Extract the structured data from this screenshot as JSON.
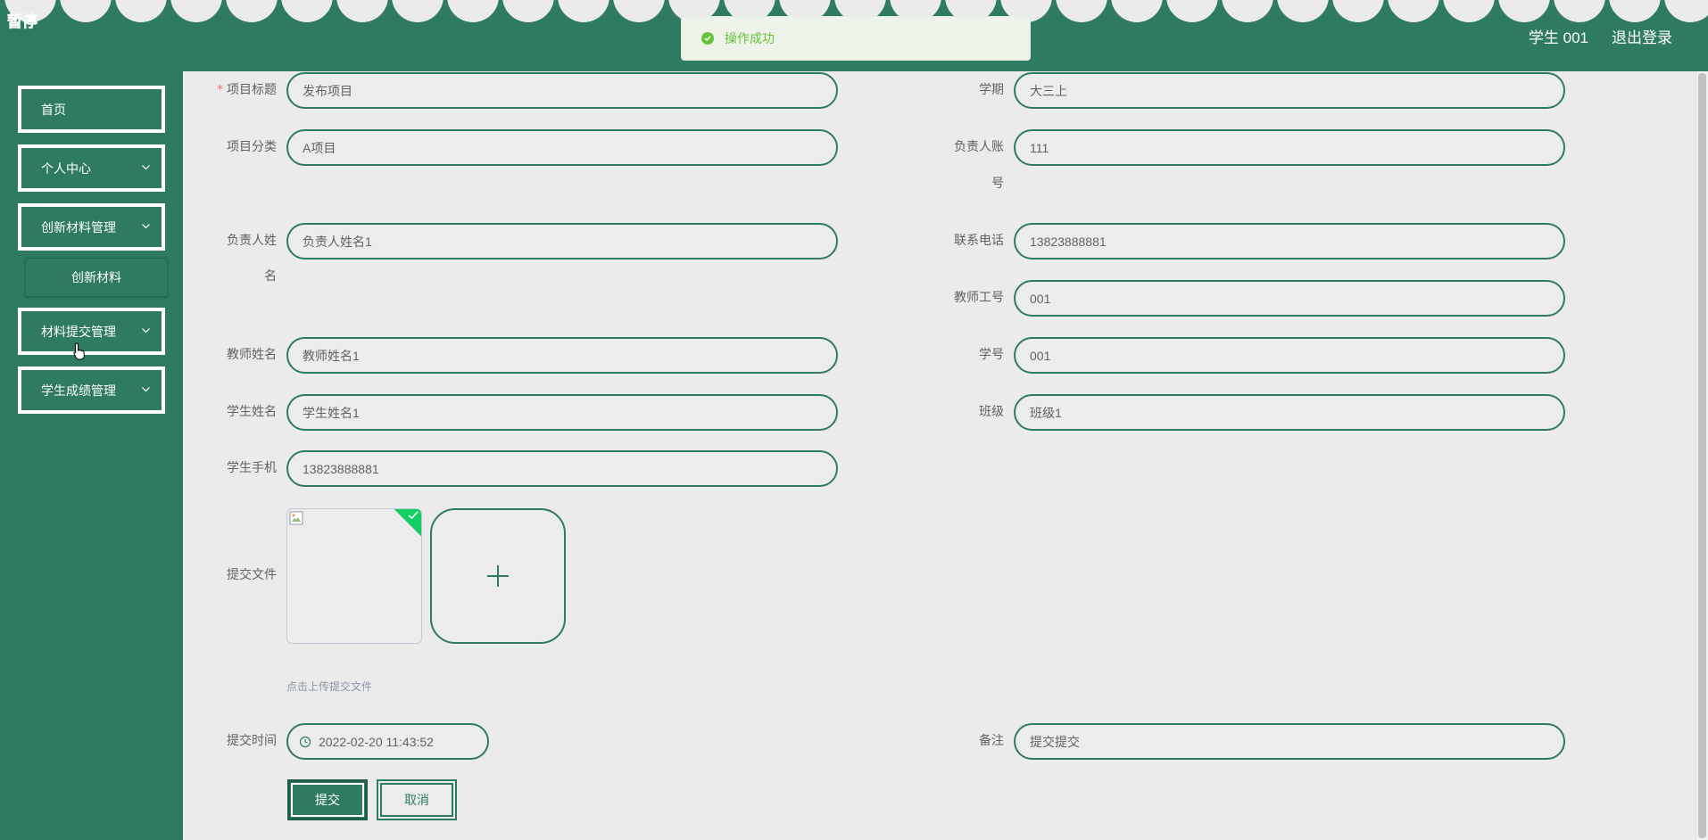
{
  "header": {
    "logo_text": "暂停",
    "username": "学生 001",
    "logout": "退出登录"
  },
  "toast": {
    "message": "操作成功"
  },
  "sidebar": {
    "items": [
      {
        "label": "首页"
      },
      {
        "label": "个人中心"
      },
      {
        "label": "创新材料管理"
      },
      {
        "label": "创新材料"
      },
      {
        "label": "材料提交管理"
      },
      {
        "label": "学生成绩管理"
      }
    ]
  },
  "form": {
    "title_label": "项目标题",
    "title_value": "发布项目",
    "semester_label": "学期",
    "semester_value": "大三上",
    "category_label": "项目分类",
    "category_value": "A项目",
    "owner_account_label_1": "负责人账",
    "owner_account_label_2": "号",
    "owner_account_value": "111",
    "owner_name_label_1": "负责人姓",
    "owner_name_label_2": "名",
    "owner_name_value": "负责人姓名1",
    "phone_label": "联系电话",
    "phone_value": "13823888881",
    "teacher_id_label": "教师工号",
    "teacher_id_value": "001",
    "teacher_name_label": "教师姓名",
    "teacher_name_value": "教师姓名1",
    "student_id_label": "学号",
    "student_id_value": "001",
    "student_name_label": "学生姓名",
    "student_name_value": "学生姓名1",
    "class_label": "班级",
    "class_value": "班级1",
    "student_phone_label": "学生手机",
    "student_phone_value": "13823888881",
    "file_label": "提交文件",
    "upload_tip": "点击上传提交文件",
    "time_label": "提交时间",
    "time_value": "2022-02-20 11:43:52",
    "remark_label": "备注",
    "remark_value": "提交提交",
    "submit_label": "提交",
    "cancel_label": "取消"
  },
  "colors": {
    "primary": "#2f7b62",
    "success": "#67c23a",
    "background": "#ebebeb"
  }
}
